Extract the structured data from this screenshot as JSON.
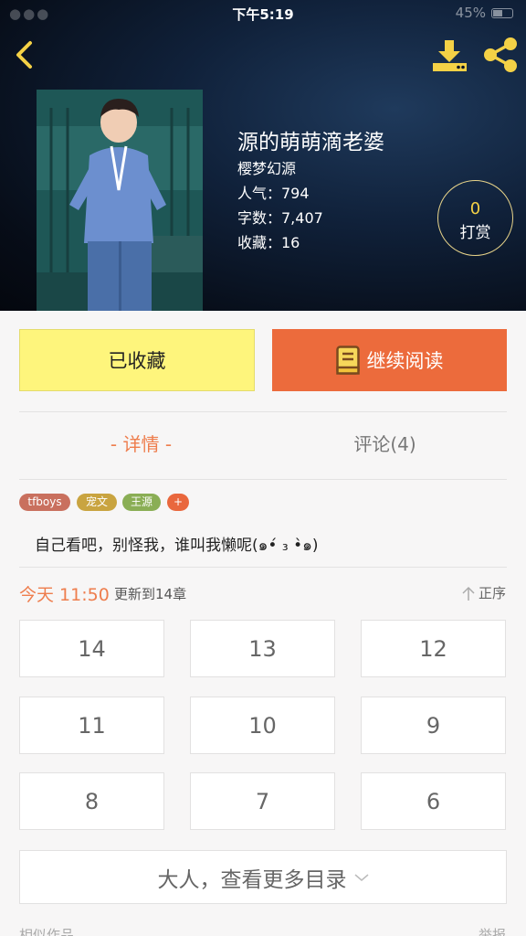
{
  "status_bar": {
    "signal": "●●●",
    "time": "下午5:19",
    "battery": "45%"
  },
  "header": {
    "title": "源的萌萌滴老婆",
    "author": "樱梦幻源",
    "popularity": "人气：794",
    "word_count": "字数：7,407",
    "favorites": "收藏：16",
    "tip_count": "0",
    "tip_label": "打赏"
  },
  "icons": {
    "back": "back-arrow-icon",
    "download": "download-icon",
    "share": "share-icon",
    "book": "book-icon",
    "sort": "up-arrow-icon",
    "expand": "chevron-down-icon"
  },
  "colors": {
    "accent": "#ee7d4d",
    "gold": "#f4d146",
    "fav_button": "#fef57c",
    "read_button": "#ec6b3c"
  },
  "actions": {
    "favorited": "已收藏",
    "continue_reading": "继续阅读"
  },
  "tabs": {
    "detail": "- 详情 -",
    "comments": "评论(4)"
  },
  "tags": [
    {
      "label": "tfboys",
      "color": "#c9705e"
    },
    {
      "label": "宠文",
      "color": "#c9a440"
    },
    {
      "label": "王源",
      "color": "#8aae55"
    },
    {
      "label": "+",
      "color": "#e9673d"
    }
  ],
  "description": "自己看吧，别怪我，谁叫我懒呢(๑•́ ₃ •̀๑)",
  "update": {
    "time": "今天 11:50",
    "text": "更新到14章",
    "sort_label": "正序"
  },
  "chapters": [
    "14",
    "13",
    "12",
    "11",
    "10",
    "9",
    "8",
    "7",
    "6"
  ],
  "more_button": "大人，查看更多目录",
  "footer": {
    "left": "相似作品",
    "right": "举报"
  }
}
